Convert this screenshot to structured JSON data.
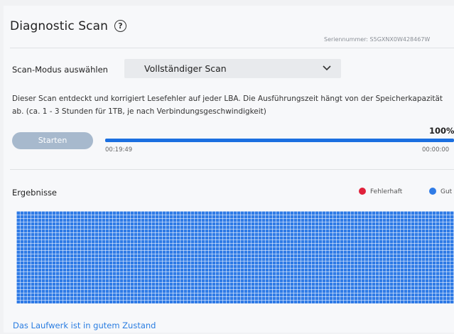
{
  "header": {
    "title": "Diagnostic Scan",
    "help_glyph": "?",
    "serial_label": "Seriennummer: S5GXNX0W428467W"
  },
  "scan_mode": {
    "label": "Scan-Modus auswählen",
    "selected": "Vollständiger Scan"
  },
  "description": "Dieser Scan entdeckt und korrigiert Lesefehler auf jeder LBA. Die Ausführungszeit hängt von der Speicherkapazität ab. (ca. 1 - 3 Stunden für 1TB, je nach Verbindungsgeschwindigkeit)",
  "controls": {
    "start_label": "Starten",
    "progress_text": "100%",
    "progress_fraction": 1.0,
    "elapsed": "00:19:49",
    "remaining": "00:00:00"
  },
  "results": {
    "title": "Ergebnisse",
    "legend": [
      {
        "label": "Fehlerhaft",
        "color": "#e0213b"
      },
      {
        "label": "Gut",
        "color": "#2f7be6"
      }
    ],
    "grid_color": "#2f7be6",
    "status": "Das Laufwerk ist in gutem Zustand"
  }
}
